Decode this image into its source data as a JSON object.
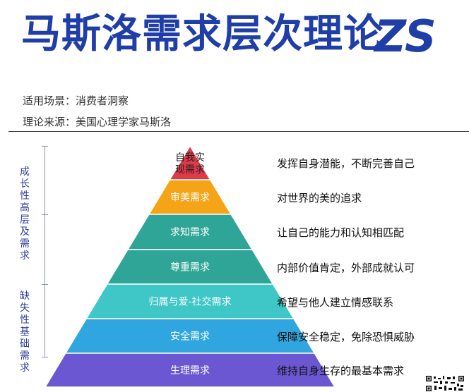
{
  "title": "马斯洛需求层次理论",
  "logo": "ZS",
  "meta": {
    "scenario": "适用场景：消费者洞察",
    "source": "理论来源：美国心理学家马斯洛"
  },
  "side_labels": {
    "growth": "成长性高层及需求",
    "deficiency": "缺失性基础需求"
  },
  "levels": [
    {
      "label": "自我实现需求",
      "desc": "发挥自身潜能，不断完善自己",
      "color": "#e1394a"
    },
    {
      "label": "审美需求",
      "desc": "对世界的美的追求",
      "color": "#f5a417"
    },
    {
      "label": "求知需求",
      "desc": "让自己的能力和认知相匹配",
      "color": "#2ea596"
    },
    {
      "label": "尊重需求",
      "desc": "内部价值肯定，外部成就认可",
      "color": "#2ea596"
    },
    {
      "label": "归属与爱-社交需求",
      "desc": "希望与他人建立情感联系",
      "color": "#3fc6c6"
    },
    {
      "label": "安全需求",
      "desc": "保障安全稳定，免除恐惧威胁",
      "color": "#2fa6df"
    },
    {
      "label": "生理需求",
      "desc": "维持自身生存的最基本需求",
      "color": "#6a57d1"
    }
  ]
}
